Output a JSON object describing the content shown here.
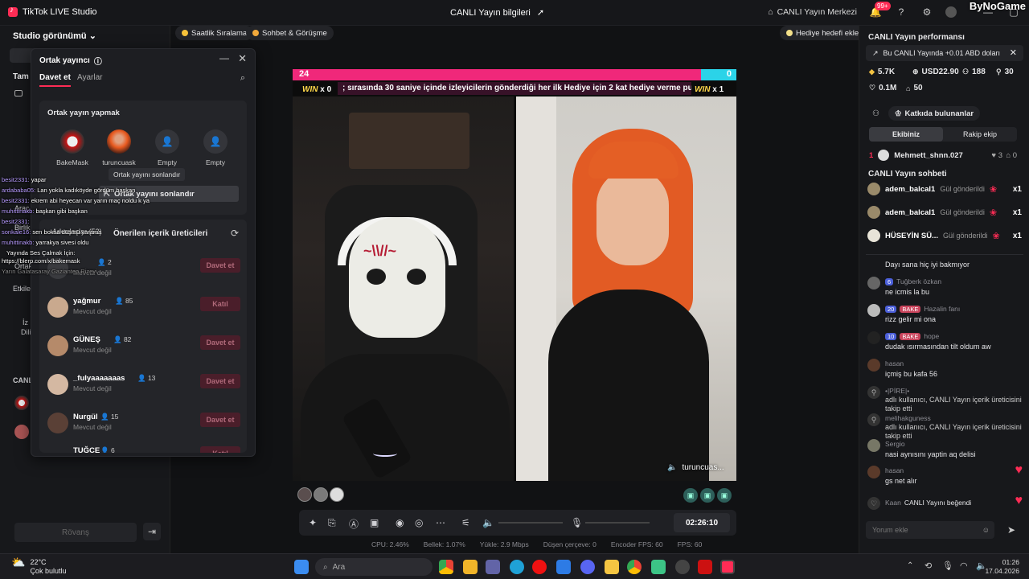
{
  "titlebar": {
    "app_title": "TikTok LIVE Studio",
    "center_title": "CANLI Yayın bilgileri",
    "live_center": "CANLI Yayın Merkezi",
    "notif_badge": "99+",
    "watermark": "ByNoGame"
  },
  "left": {
    "studio_view": "Studio görünümü",
    "tam": "Tam",
    "labels": [
      "Araç",
      "Birlik",
      "Ortak",
      "Etkile",
      "İz",
      "Dili",
      "CANL"
    ],
    "rovans": "Rövanş"
  },
  "toolbar": {
    "hourly_rank": "Saatlik Sıralama",
    "chat_meet": "Sohbet & Görüşme",
    "gift_goal": "Hediye hedefi ekle"
  },
  "popup": {
    "title": "Ortak yayıncı",
    "tab_invite": "Davet et",
    "tab_settings": "Ayarlar",
    "cohost_title": "Ortak yayın yapmak",
    "slots": [
      {
        "name": "BakeMask"
      },
      {
        "name": "turuncuask"
      },
      {
        "name": "Empty"
      },
      {
        "name": "Empty"
      }
    ],
    "tooltip": "Ortak yayını sonlandır",
    "end_button": "Ortak yayını sonlandır",
    "friends_tab": "Arkadaşlar (52)",
    "suggested_title": "Önerilen içerik üreticileri",
    "invite_label": "Davet et",
    "join_label": "Katıl",
    "unavailable": "Mevcut değil",
    "rows": [
      {
        "name": "",
        "count": "2",
        "status": "Mevcut değil",
        "action": "Davet et"
      },
      {
        "name": "yağmur",
        "count": "85",
        "status": "Mevcut değil",
        "action": "Katıl"
      },
      {
        "name": "GÜNEŞ",
        "count": "82",
        "status": "Mevcut değil",
        "action": "Davet et"
      },
      {
        "name": "_fulyaaaaaaas",
        "count": "13",
        "status": "Mevcut değil",
        "action": "Davet et"
      },
      {
        "name": "Nurgül",
        "count": "15",
        "status": "Mevcut değil",
        "action": "Davet et"
      },
      {
        "name": "TUĞÇE",
        "count": "6",
        "status": "",
        "action": "Katıl"
      }
    ]
  },
  "overlay_chat": [
    {
      "user": "besit2331:",
      "text": "yapar"
    },
    {
      "user": "ardababa05:",
      "text": "Lan yokla kadıköyde gördüm başkan"
    },
    {
      "user": "besit2331:",
      "text": "ekrem abi heyecan var yarın maç noldu k ya"
    },
    {
      "user": "muhittinakb:",
      "text": "başkan gibi başkan"
    },
    {
      "user": "besit2331:",
      "text": ""
    },
    {
      "user": "sonkale16:",
      "text": "sen boksa düşmü yarama"
    },
    {
      "user": "muhittinakb:",
      "text": "yarrakya sivesi oldu"
    },
    {
      "user": "",
      "text": "Yayında Ses Çalmak İçin:"
    },
    {
      "user": "",
      "text": "https://blerp.com/x/bakemask"
    },
    {
      "user": "",
      "text": "Yarın Galatasaray Gaziantep Rizeyi"
    }
  ],
  "stream": {
    "left_score": "24",
    "right_score": "0",
    "ticker": "; sırasında 30 saniye içinde izleyicilerin gönderdiği her ilk Hediye için 2 kat hediye verme pu",
    "win_left": "x 0",
    "win_right": "x 1",
    "win_word": "WIN",
    "guest_label": "turuncuas...",
    "timer": "02:26:10",
    "pk_progress": 0.92
  },
  "stats": {
    "cpu": "CPU: 2.46%",
    "mem": "Bellek: 1.07%",
    "upload": "Yükle: 2.9 Mbps",
    "dropped": "Düşen çerçeve: 0",
    "encoder": "Encoder FPS: 60",
    "fps": "FPS: 60"
  },
  "right": {
    "perf_title": "CANLI Yayın performansı",
    "info": "Bu CANLI Yayında +0.01 ABD doları",
    "metrics": {
      "m1": "5.7K",
      "m2": "USD22.90",
      "m3": "188",
      "m4": "30",
      "m5": "0.1M",
      "m6": "50"
    },
    "contributors": "Katkıda bulunanlar",
    "team_tab": "Ekibiniz",
    "rival_tab": "Rakip ekip",
    "rank_no": "1",
    "rank_name": "Mehmett_shnn.027",
    "rank_a": "3",
    "rank_b": "0",
    "chat_title": "CANLI Yayın sohbeti",
    "gifts": [
      {
        "name": "adem_balcal1",
        "text": "Gül gönderildi",
        "mult": "x1"
      },
      {
        "name": "adem_balcal1",
        "text": "Gül gönderildi",
        "mult": "x1"
      },
      {
        "name": "HÜSEYİN SÜ...",
        "text": "Gül gönderildi",
        "mult": "x1"
      }
    ],
    "messages": [
      {
        "head": "",
        "lvl": "",
        "fan": "",
        "text": "Dayı sana hiç iyi bakmıyor"
      },
      {
        "head": "Tuğberk özkan",
        "lvl": "6",
        "fan": "",
        "text": "ne icmis la bu"
      },
      {
        "head": "Hazalin fanı",
        "lvl": "20",
        "fan": "BAKE",
        "text": "rizz gelir mi ona"
      },
      {
        "head": "hope",
        "lvl": "10",
        "fan": "BAKE",
        "text": "dudak ısırmasından tilt oldum aw"
      },
      {
        "head": "hasan",
        "lvl": "",
        "fan": "",
        "text": "içmiş bu kafa 56"
      },
      {
        "head": "•|PİRE|•",
        "lvl": "",
        "fan": "",
        "text": "adlı kullanıcı, CANLI Yayın içerik üreticisini takip etti"
      },
      {
        "head": "melihakguness",
        "lvl": "",
        "fan": "",
        "text": "adlı kullanıcı, CANLI Yayın içerik üreticisini takip etti"
      },
      {
        "head": "Sergio",
        "lvl": "",
        "fan": "",
        "text": "nasi aynısını yaptin aq delisi"
      },
      {
        "head": "hasan",
        "lvl": "",
        "fan": "",
        "text": "gs net alır"
      }
    ],
    "liked": "Kaan",
    "liked_text": "CANLI Yayını beğendi",
    "comment_placeholder": "Yorum ekle"
  },
  "taskbar": {
    "temp": "22°C",
    "weather": "Çok bulutlu",
    "search": "Ara",
    "time": "01:26",
    "date": "17.04.2026"
  }
}
